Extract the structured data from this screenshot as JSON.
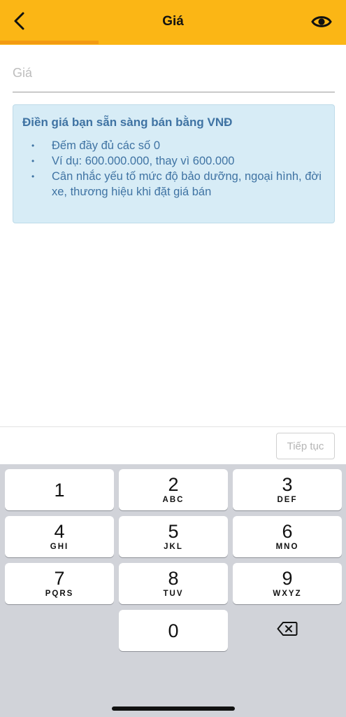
{
  "header": {
    "title": "Giá",
    "back_icon": "chevron-left-icon",
    "eye_icon": "eye-icon",
    "colors": {
      "background": "#fbb615",
      "progress": "#f39a12"
    },
    "progress": 0.285
  },
  "price_input": {
    "placeholder": "Giá",
    "value": ""
  },
  "info": {
    "title": "Điền giá bạn sẵn sàng bán bằng VNĐ",
    "items": [
      "Đếm đầy đủ các số 0",
      "Ví dụ: 600.000.000, thay vì 600.000",
      "Cân nhắc yếu tố mức độ bảo dưỡng, ngoại hình, đời xe, thương hiệu khi đặt giá bán"
    ]
  },
  "continue_button": {
    "label": "Tiếp tục"
  },
  "keypad": {
    "keys": [
      {
        "digit": "1",
        "letters": ""
      },
      {
        "digit": "2",
        "letters": "ABC"
      },
      {
        "digit": "3",
        "letters": "DEF"
      },
      {
        "digit": "4",
        "letters": "GHI"
      },
      {
        "digit": "5",
        "letters": "JKL"
      },
      {
        "digit": "6",
        "letters": "MNO"
      },
      {
        "digit": "7",
        "letters": "PQRS"
      },
      {
        "digit": "8",
        "letters": "TUV"
      },
      {
        "digit": "9",
        "letters": "WXYZ"
      },
      {
        "digit": "0",
        "letters": ""
      }
    ],
    "backspace_icon": "backspace-icon"
  }
}
